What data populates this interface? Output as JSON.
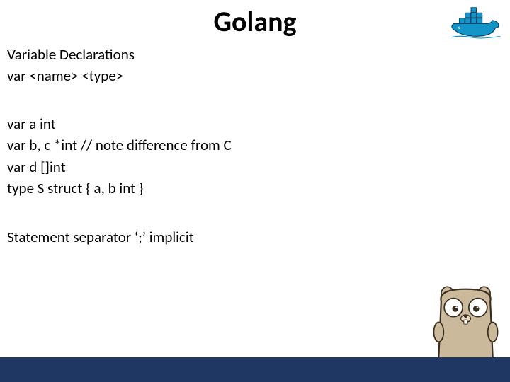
{
  "title": "Golang",
  "section1": {
    "heading": "Variable Declarations",
    "syntax": "var <name> <type>"
  },
  "section2": {
    "line1": "var a int",
    "line2": "var b, c *int // note difference from C",
    "line3": "var d []int",
    "line4": "type S struct { a, b int }"
  },
  "section3": {
    "line1": "Statement separator ‘;’ implicit"
  }
}
